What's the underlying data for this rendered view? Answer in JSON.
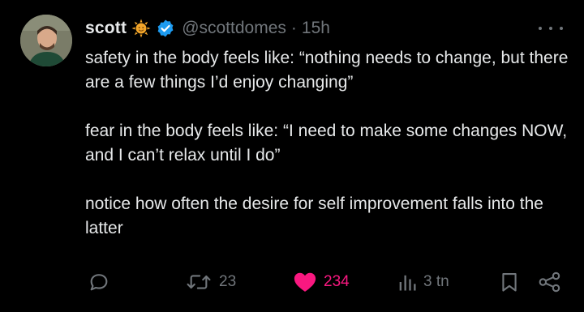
{
  "tweet": {
    "author_name": "scott",
    "handle": "@scottdomes",
    "separator": "·",
    "time": "15h",
    "paragraphs": [
      "safety in the body feels like: “nothing needs to change, but there are a few things I’d enjoy changing”",
      "fear in the body feels like: “I need to make some changes NOW, and I can’t relax until I do”",
      "notice how often the desire for self improvement falls into the latter"
    ]
  },
  "actions": {
    "reply_icon": "reply-icon",
    "retweet_count": "23",
    "like_count": "234",
    "views_count": "3 tn",
    "bookmark_icon": "bookmark-icon",
    "share_icon": "share-icon"
  },
  "colors": {
    "background": "#000000",
    "text": "#e7e9ea",
    "muted": "#71767b",
    "like": "#f91880",
    "verified": "#1d9bf0"
  }
}
